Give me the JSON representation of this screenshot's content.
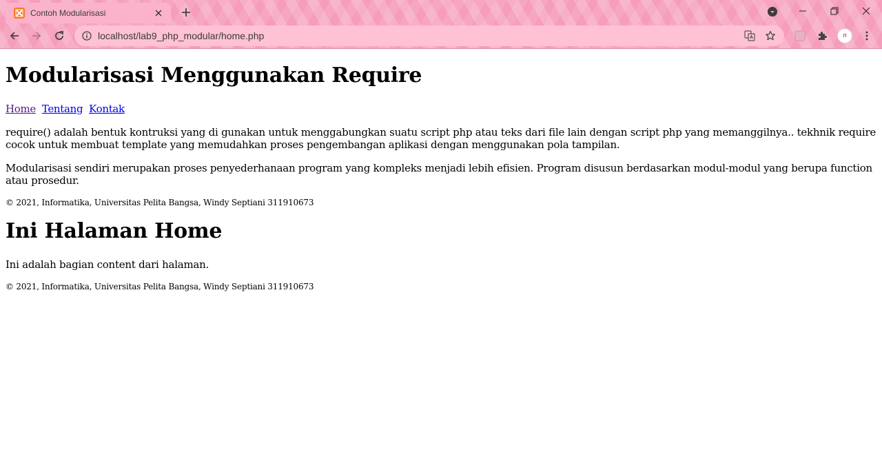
{
  "browser": {
    "tab_title": "Contoh Modularisasi",
    "url": "localhost/lab9_php_modular/home.php",
    "avatar_text": "ᴨ"
  },
  "page": {
    "heading": "Modularisasi Menggunakan Require",
    "nav": {
      "home": "Home",
      "tentang": "Tentang",
      "kontak": "Kontak"
    },
    "paragraph1": "require() adalah bentuk kontruksi yang di gunakan untuk menggabungkan suatu script php atau teks dari file lain dengan script php yang memanggilnya.. tekhnik require cocok untuk membuat template yang memudahkan proses pengembangan aplikasi dengan menggunakan pola tampilan.",
    "paragraph2": "Modularisasi sendiri merupakan proses penyederhanaan program yang kompleks menjadi lebih efisien. Program disusun berdasarkan modul-modul yang berupa function atau prosedur.",
    "footer": "© 2021, Informatika, Universitas Pelita Bangsa, Windy Septiani 311910673",
    "content_heading": "Ini Halaman Home",
    "content_text": "Ini adalah bagian content dari halaman.",
    "footer2": "© 2021, Informatika, Universitas Pelita Bangsa, Windy Septiani 311910673"
  },
  "colors": {
    "chrome_accent": "#f7a6c1",
    "link": "#0000ee",
    "visited_link": "#551a8b"
  }
}
